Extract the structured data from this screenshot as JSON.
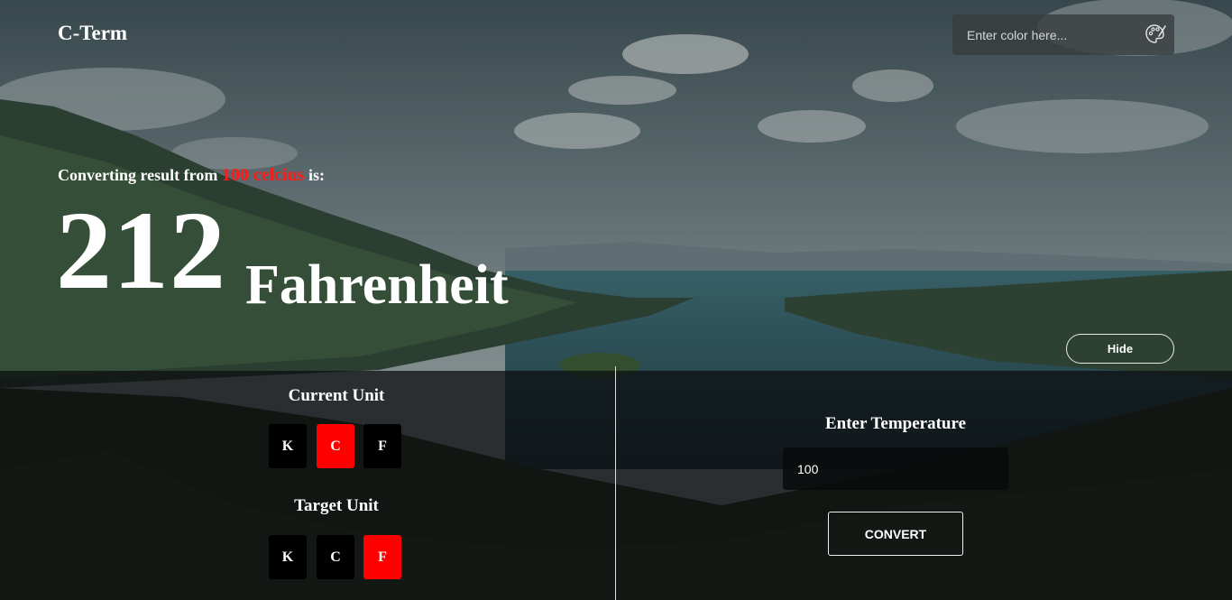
{
  "brand": {
    "title": "C-Term"
  },
  "color_input": {
    "placeholder": "Enter color here...",
    "value": "",
    "icon": "palette-icon"
  },
  "result": {
    "prefix": "Converting result from ",
    "source_value": "100 celcius",
    "suffix": " is:",
    "value": "212",
    "unit": "Fahrenheit"
  },
  "hide_button": {
    "label": "Hide"
  },
  "current_unit": {
    "title": "Current Unit",
    "options": [
      {
        "label": "K",
        "active": false
      },
      {
        "label": "C",
        "active": true
      },
      {
        "label": "F",
        "active": false
      }
    ]
  },
  "target_unit": {
    "title": "Target Unit",
    "options": [
      {
        "label": "K",
        "active": false
      },
      {
        "label": "C",
        "active": false
      },
      {
        "label": "F",
        "active": true
      }
    ]
  },
  "temperature": {
    "title": "Enter Temperature",
    "value": "100"
  },
  "convert_button": {
    "label": "CONVERT"
  },
  "colors": {
    "accent": "#ff0000",
    "highlight_text": "#ff1a1a",
    "panel": "#0c0e10"
  }
}
